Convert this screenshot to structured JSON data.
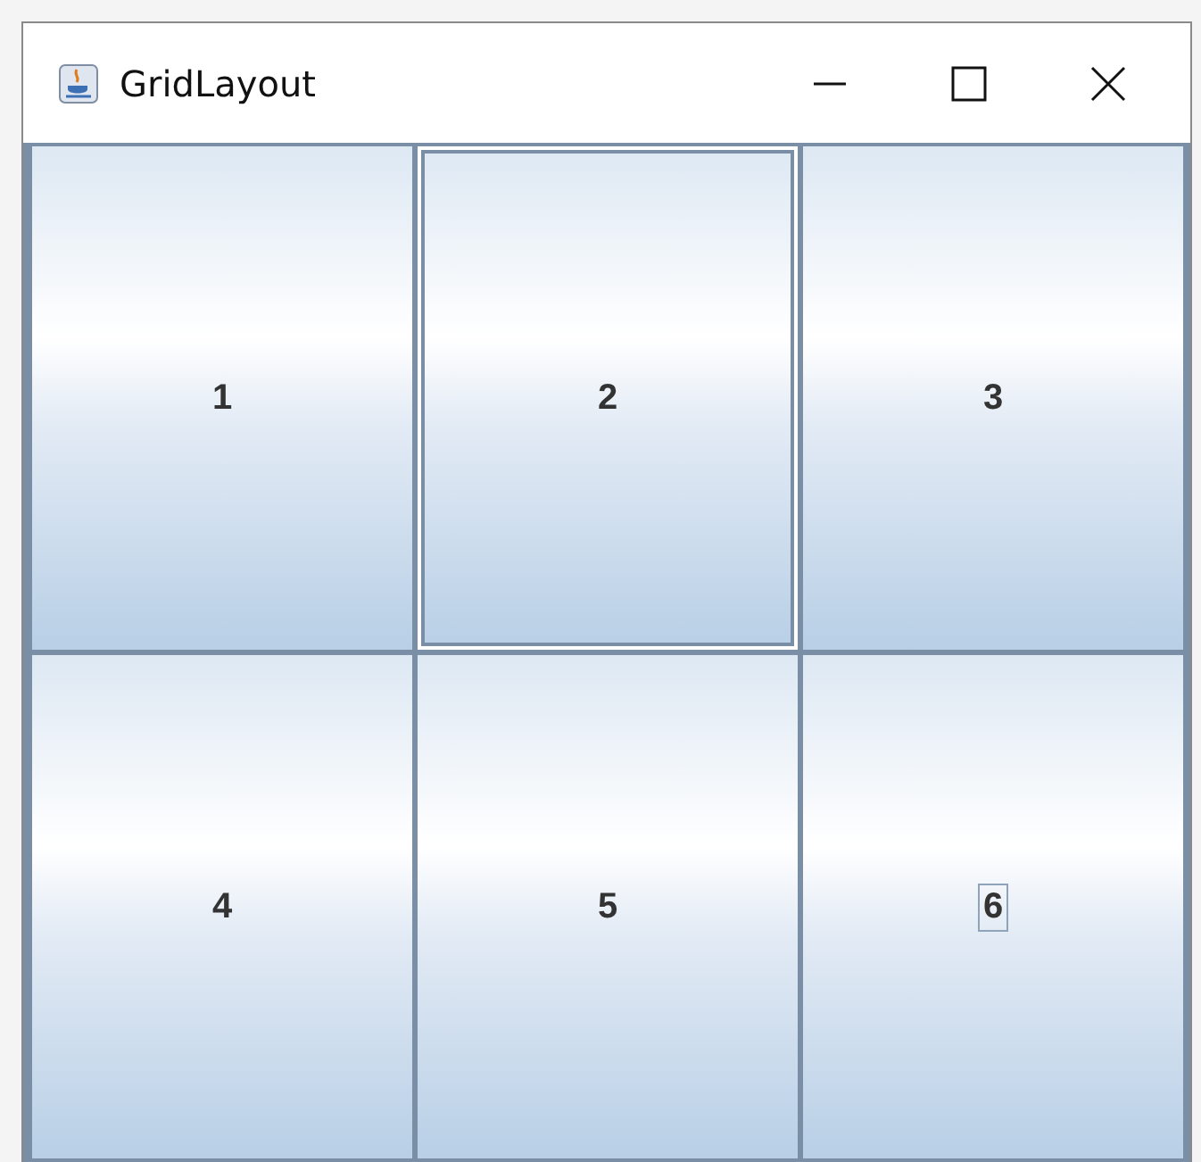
{
  "window": {
    "title": "GridLayout"
  },
  "buttons": [
    {
      "label": "1",
      "hovered": false,
      "focused": false
    },
    {
      "label": "2",
      "hovered": true,
      "focused": false
    },
    {
      "label": "3",
      "hovered": false,
      "focused": false
    },
    {
      "label": "4",
      "hovered": false,
      "focused": false
    },
    {
      "label": "5",
      "hovered": false,
      "focused": false
    },
    {
      "label": "6",
      "hovered": false,
      "focused": true
    }
  ]
}
